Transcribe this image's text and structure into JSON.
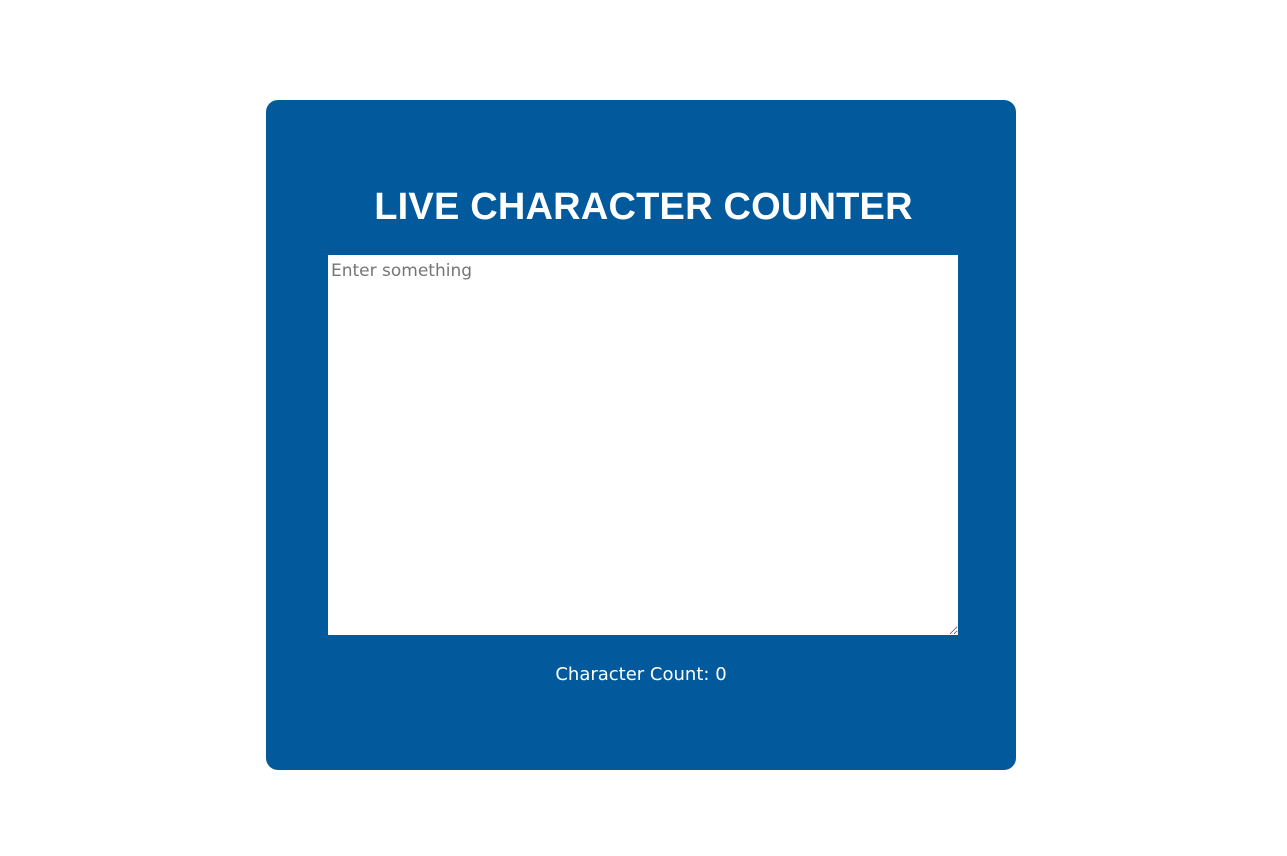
{
  "app": {
    "title": "LIVE CHARACTER COUNTER",
    "textarea": {
      "value": "",
      "placeholder": "Enter something"
    },
    "counter": {
      "label": "Character Count:",
      "value": 0
    }
  },
  "colors": {
    "page_background": "#ffffff",
    "card_background": "#025a9c",
    "text_light": "#ffffff",
    "placeholder": "#757575"
  }
}
